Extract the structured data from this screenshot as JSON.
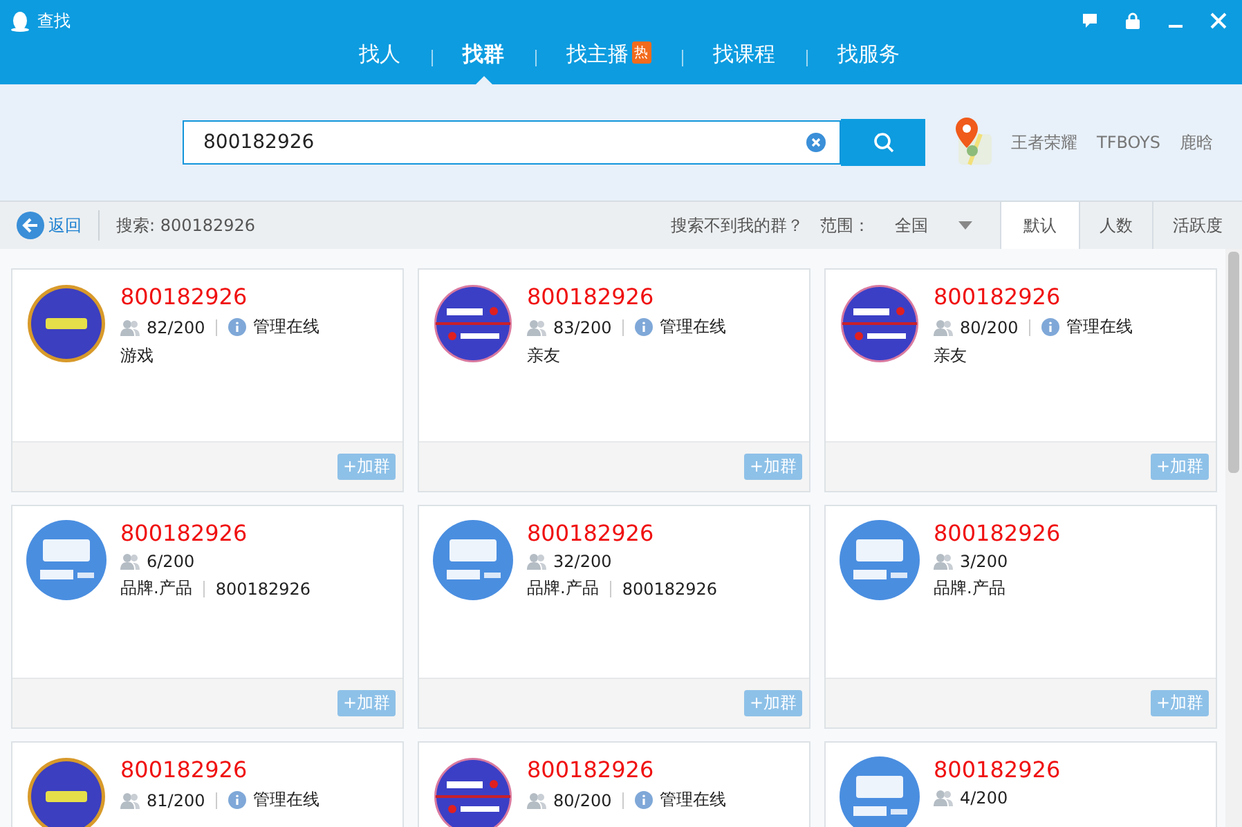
{
  "window": {
    "title": "查找"
  },
  "tabs": [
    {
      "label": "找人",
      "selected": false
    },
    {
      "label": "找群",
      "selected": true
    },
    {
      "label": "找主播",
      "selected": false,
      "badge": "热"
    },
    {
      "label": "找课程",
      "selected": false
    },
    {
      "label": "找服务",
      "selected": false
    }
  ],
  "search": {
    "value": "800182926"
  },
  "hot_keywords": [
    "王者荣耀",
    "TFBOYS",
    "鹿晗"
  ],
  "toolbar": {
    "back": "返回",
    "query": "搜索: 800182926",
    "help_link": "搜索不到我的群？",
    "scope_label": "范围：",
    "scope_value": "全国",
    "sorts": [
      {
        "label": "默认",
        "selected": true
      },
      {
        "label": "人数",
        "selected": false
      },
      {
        "label": "活跃度",
        "selected": false
      }
    ]
  },
  "groups": [
    {
      "kind": "gold-ring",
      "number": "800182926",
      "members": "82/200",
      "admin_text": "管理在线",
      "tags": [
        "游戏"
      ],
      "join": "+加群"
    },
    {
      "kind": "badge-24h",
      "number": "800182926",
      "members": "83/200",
      "admin_text": "管理在线",
      "tags": [
        "亲友"
      ],
      "join": "+加群"
    },
    {
      "kind": "badge-24h",
      "number": "800182926",
      "members": "80/200",
      "admin_text": "管理在线",
      "tags": [
        "亲友"
      ],
      "join": "+加群"
    },
    {
      "kind": "blue-circle",
      "number": "800182926",
      "members": "6/200",
      "tags": [
        "品牌.产品",
        "800182926"
      ],
      "join": "+加群"
    },
    {
      "kind": "blue-circle",
      "number": "800182926",
      "members": "32/200",
      "tags": [
        "品牌.产品",
        "800182926"
      ],
      "join": "+加群"
    },
    {
      "kind": "blue-circle",
      "number": "800182926",
      "members": "3/200",
      "tags": [
        "品牌.产品"
      ],
      "join": "+加群"
    },
    {
      "kind": "gold-ring",
      "number": "800182926",
      "members": "81/200",
      "admin_text": "管理在线"
    },
    {
      "kind": "badge-24h",
      "number": "800182926",
      "members": "80/200",
      "admin_text": "管理在线"
    },
    {
      "kind": "blue-circle",
      "number": "800182926",
      "members": "4/200"
    }
  ]
}
